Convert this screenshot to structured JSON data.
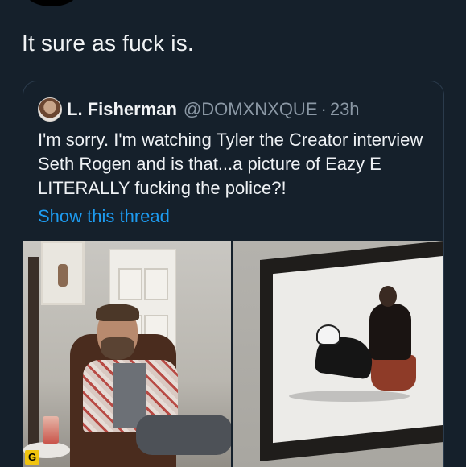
{
  "tweet": {
    "text": "It sure as fuck is."
  },
  "quote": {
    "name": "L. Fisherman",
    "handle": "@DOMXNXQUE",
    "separator": "·",
    "time": "23h",
    "text": "I'm sorry. I'm watching Tyler the Creator interview Seth Rogen and is that...a picture of Eazy E LITERALLY fucking the police?!",
    "thread_link": "Show this thread"
  },
  "media": {
    "badge": "G"
  }
}
